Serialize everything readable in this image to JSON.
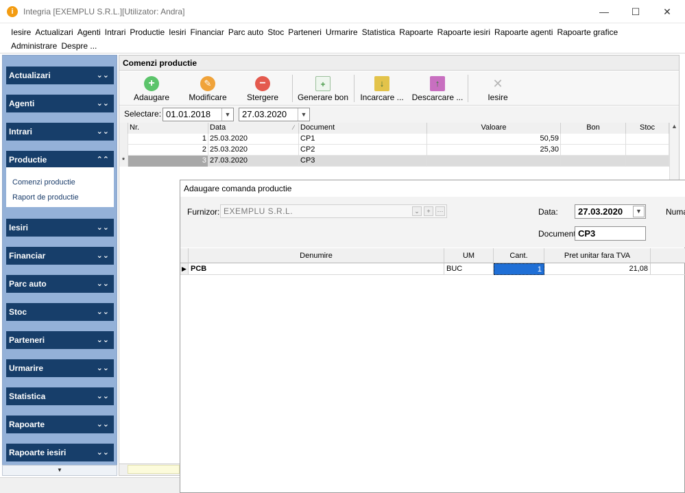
{
  "window": {
    "title": "Integria [EXEMPLU S.R.L.][Utilizator: Andra]",
    "minimize": "—",
    "maximize": "☐",
    "close": "✕"
  },
  "menu": [
    "Iesire",
    "Actualizari",
    "Agenti",
    "Intrari",
    "Productie",
    "Iesiri",
    "Financiar",
    "Parc auto",
    "Stoc",
    "Parteneri",
    "Urmarire",
    "Statistica",
    "Rapoarte",
    "Rapoarte iesiri",
    "Rapoarte agenti",
    "Rapoarte grafice",
    "Administrare",
    "Despre ..."
  ],
  "sidebar": {
    "groups": [
      "Actualizari",
      "Agenti",
      "Intrari",
      "Productie",
      "Iesiri",
      "Financiar",
      "Parc auto",
      "Stoc",
      "Parteneri",
      "Urmarire",
      "Statistica",
      "Rapoarte",
      "Rapoarte iesiri"
    ],
    "expanded_items": [
      "Comenzi productie",
      "Raport de productie"
    ]
  },
  "main": {
    "header": "Comenzi productie",
    "toolbar": [
      "Adaugare",
      "Modificare",
      "Stergere",
      "Generare bon",
      "Incarcare ...",
      "Descarcare ...",
      "Iesire"
    ],
    "selector_label": "Selectare:",
    "date_from": "01.01.2018",
    "date_to": "27.03.2020",
    "columns": [
      "Nr.",
      "Data",
      "Document",
      "Valoare",
      "Bon",
      "Stoc"
    ],
    "rows": [
      {
        "marker": "",
        "nr": "1",
        "data": "25.03.2020",
        "document": "CP1",
        "valoare": "50,59",
        "bon": "",
        "stoc": ""
      },
      {
        "marker": "",
        "nr": "2",
        "data": "25.03.2020",
        "document": "CP2",
        "valoare": "25,30",
        "bon": "",
        "stoc": ""
      },
      {
        "marker": "*",
        "nr": "3",
        "data": "27.03.2020",
        "document": "CP3",
        "valoare": "",
        "bon": "",
        "stoc": ""
      }
    ]
  },
  "dialog": {
    "title": "Adaugare comanda productie",
    "furnizor_label": "Furnizor:",
    "furnizor_value": "EXEMPLU S.R.L.",
    "data_label": "Data:",
    "data_value": "27.03.2020",
    "numar_label": "Numa",
    "document_label": "Document:",
    "document_value": "CP3",
    "columns": [
      "Denumire",
      "UM",
      "Cant.",
      "Pret unitar fara TVA"
    ],
    "rows": [
      {
        "denumire": "PCB",
        "um": "BUC",
        "cant": "1",
        "pret": "21,08"
      }
    ]
  },
  "colors": {
    "sidebar_header": "#173e6a",
    "sidebar_bg": "#94b1d8",
    "selected_cell": "#1f6fd6"
  }
}
